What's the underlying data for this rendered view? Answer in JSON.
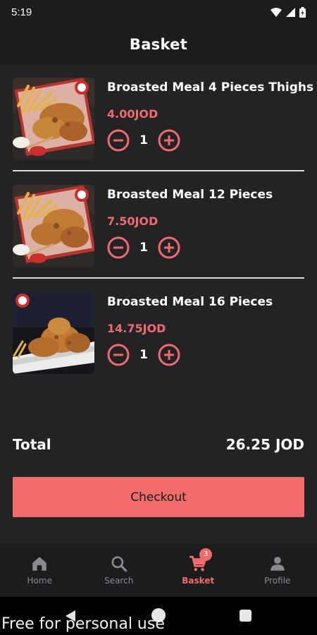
{
  "status_bar": {
    "time": "5:19",
    "icons": [
      "wifi-icon",
      "signal-icon",
      "battery-icon"
    ]
  },
  "header": {
    "title": "Basket"
  },
  "basket": {
    "items": [
      {
        "name": "Broasted Meal 4 Pieces Thighs",
        "price": "4.00JOD",
        "quantity": "1",
        "image": "fried-chicken-fries-photo"
      },
      {
        "name": "Broasted Meal 12 Pieces",
        "price": "7.50JOD",
        "quantity": "1",
        "image": "fried-chicken-fries-photo"
      },
      {
        "name": "Broasted Meal 16 Pieces",
        "price": "14.75JOD",
        "quantity": "1",
        "image": "fried-chicken-plate-photo"
      }
    ]
  },
  "summary": {
    "total_label": "Total",
    "total_value": "26.25 JOD"
  },
  "checkout": {
    "label": "Checkout"
  },
  "bottom_nav": {
    "items": [
      {
        "label": "Home",
        "icon": "home-icon"
      },
      {
        "label": "Search",
        "icon": "search-icon"
      },
      {
        "label": "Basket",
        "icon": "cart-icon",
        "badge": "3",
        "active": true
      },
      {
        "label": "Profile",
        "icon": "person-icon"
      }
    ]
  },
  "watermark": "Free for personal use",
  "colors": {
    "accent": "#f36c6c",
    "background": "#232326",
    "bar_background": "#1c1c1f",
    "inactive": "#8a8a8e"
  }
}
